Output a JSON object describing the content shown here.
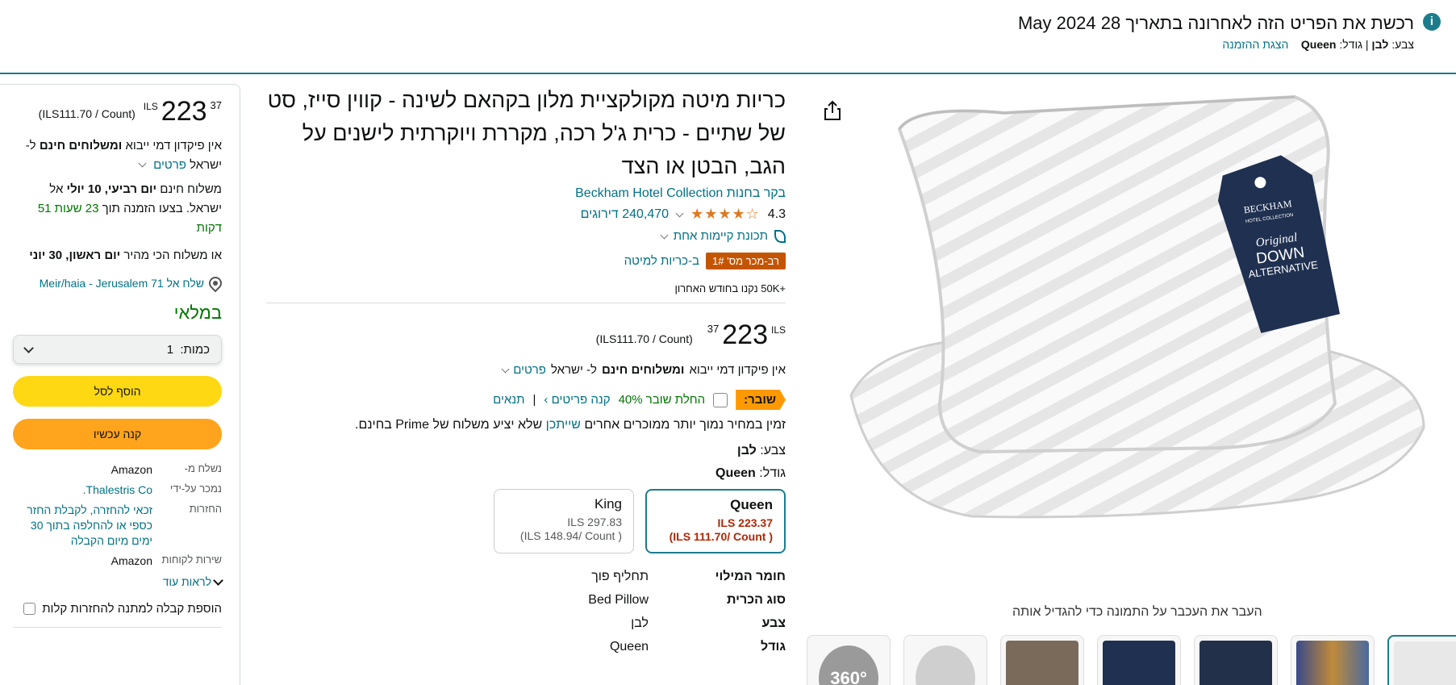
{
  "notice": {
    "line1": "רכשת את הפריט הזה לאחרונה בתאריך 28 May 2024",
    "color_label": "צבע:",
    "color_value": "לבן",
    "size_label": "גודל:",
    "size_value": "Queen",
    "view_order": "הצגת ההזמנה"
  },
  "buybox": {
    "currency": "ILS",
    "price_whole": "223",
    "price_fraction": "37",
    "unit_price": "(ILS111.70 / Count)",
    "no_deposit_prefix": "אין פיקדון דמי ייבוא",
    "no_deposit_bold": "ומשלוחים חינם",
    "to_israel": "ל- ישראל",
    "details_link": "פרטים",
    "free_delivery_prefix": "משלוח חינם",
    "free_delivery_date": "יום רביעי, 10 יולי",
    "free_delivery_suffix": "אל ישראל. בצעו הזמנה תוך",
    "countdown": "23 שעות 51 דקות",
    "fastest_prefix": "או משלוח הכי מהיר",
    "fastest_date": "יום ראשון, 30 יוני",
    "address": "שלח אל 71 Meir/haia - Jerusalem",
    "in_stock": "במלאי",
    "qty_label": "כמות:",
    "qty_value": "1",
    "add_to_cart": "הוסף לסל",
    "buy_now": "קנה עכשיו",
    "facts": [
      {
        "label": "נשלח מ-",
        "value": "Amazon",
        "link": false
      },
      {
        "label": "נמכר על-ידי",
        "value": "Thalestris Co.",
        "link": true
      },
      {
        "label": "החזרות",
        "value": "זכאי להחזרה, לקבלת החזר כספי או להחלפה בתוך 30 ימים מיום הקבלה",
        "link": true
      },
      {
        "label": "שירות לקוחות",
        "value": "Amazon",
        "link": false
      }
    ],
    "see_more": "לראות עוד",
    "gift_receipt": "הוספת קבלה למתנה להחזרות קלות"
  },
  "product": {
    "title": "כריות מיטה מקולקציית מלון בקהאם לשינה - קווין סייז, סט של שתיים - כרית ג'ל רכה, מקררת ויוקרתית לישנים על הגב, הבטן או הצד",
    "store": "בקר בחנות Beckham Hotel Collection",
    "rating": "4.3",
    "stars": "★★★★☆",
    "ratings_count": "240,470 דירוגים",
    "climate": "תכונת קיימות אחת",
    "badge": "רב-מכר מס' 1#",
    "badge_category": "ב-כריות למיטה",
    "bought": "+50K נקנו בחודש האחרון",
    "currency": "ILS",
    "price_whole": "223",
    "price_fraction": "37",
    "unit_price": "(ILS111.70 / Count)",
    "ship_prefix": "אין פיקדון דמי ייבוא",
    "ship_bold": "ומשלוחים חינם",
    "ship_suffix": "ל- ישראל",
    "ship_details": "פרטים",
    "coupon_tag": "שובר:",
    "coupon_text": "החלת שובר 40%",
    "coupon_shop": "קנה פריטים ›",
    "coupon_terms": "תנאים",
    "prime_prefix": "זמין במחיר נמוך יותר ממוכרים אחרים",
    "prime_link": "שייתכן",
    "prime_suffix": "שלא יציע משלוח של Prime בחינם.",
    "color_label": "צבע:",
    "color_value": "לבן",
    "size_label": "גודל:",
    "size_value": "Queen",
    "sizes": [
      {
        "name": "Queen",
        "price": "ILS 223.37",
        "unit": "( ILS 111.70/ Count)"
      },
      {
        "name": "King",
        "price": "ILS 297.83",
        "unit": "( ILS 148.94/ Count)"
      }
    ],
    "specs": [
      {
        "k": "חומר המילוי",
        "v": "תחליף פוך"
      },
      {
        "k": "סוג הכרית",
        "v": "Bed Pillow"
      },
      {
        "k": "צבע",
        "v": "לבן"
      },
      {
        "k": "גודל",
        "v": "Queen"
      }
    ]
  },
  "image": {
    "tag_brand": "BECKHAM",
    "tag_sub": "HOTEL COLLECTION",
    "tag_line1": "Original",
    "tag_line2": "DOWN",
    "tag_line3": "ALTERNATIVE",
    "zoom_hint": "העבר את העכבר על התמונה כדי להגדיל אותה",
    "thumb_360": "360°"
  },
  "colors": {
    "link": "#007185",
    "badge": "#c45500",
    "cart": "#ffd814",
    "buy": "#ffa41c",
    "in_stock": "#007600",
    "tag_navy": "#1f3050"
  }
}
